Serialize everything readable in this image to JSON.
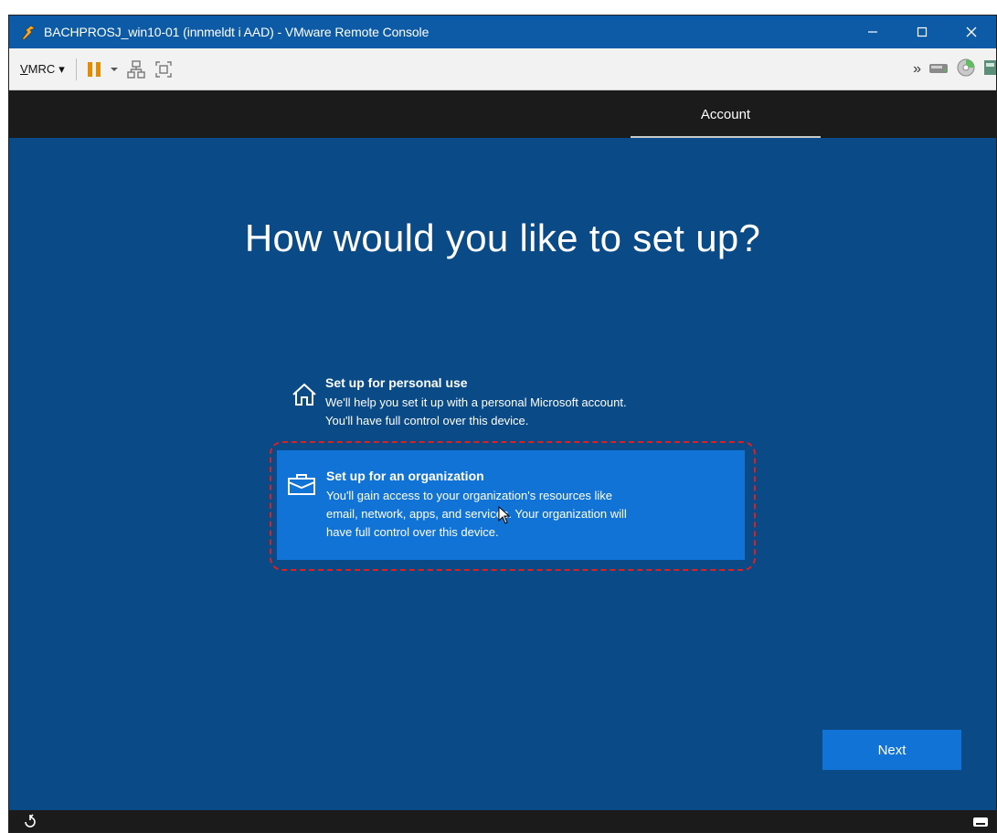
{
  "window": {
    "title": "BACHPROSJ_win10-01 (innmeldt i AAD) - VMware Remote Console",
    "controls": {
      "minimize": "–",
      "maximize": "☐",
      "close": "✕"
    }
  },
  "toolbar": {
    "menu_label_underlined": "V",
    "menu_label_rest": "MRC",
    "menu_caret": "▾",
    "overflow": "»",
    "icons": [
      "pause-icon",
      "dropdown-caret-icon",
      "network-icon",
      "fit-screen-icon",
      "removable-drive-icon",
      "cd-dvd-icon",
      "network-adapter-icon"
    ]
  },
  "oobe": {
    "tab": "Account",
    "heading": "How would you like to set up?",
    "options": [
      {
        "icon": "home-icon",
        "title": "Set up for personal use",
        "desc_line1": "We'll help you set it up with a personal Microsoft account.",
        "desc_line2": "You'll have full control over this device."
      },
      {
        "icon": "briefcase-icon",
        "title": "Set up for an organization",
        "desc_line1": "You'll gain access to your organization's resources like",
        "desc_line2": "email, network, apps, and services. Your organization will",
        "desc_line3": "have full control over this device.",
        "selected": true
      }
    ],
    "next_label": "Next"
  },
  "colors": {
    "titlebar": "#0d5aa6",
    "oobe_background": "#0a4a86",
    "accent": "#1273d6",
    "highlight_ring": "#e01f1f",
    "bar_dark": "#1b1b1b"
  },
  "bottom_bar": {
    "left_icon": "ease-of-access-icon",
    "right_icon": "keyboard-icon"
  }
}
